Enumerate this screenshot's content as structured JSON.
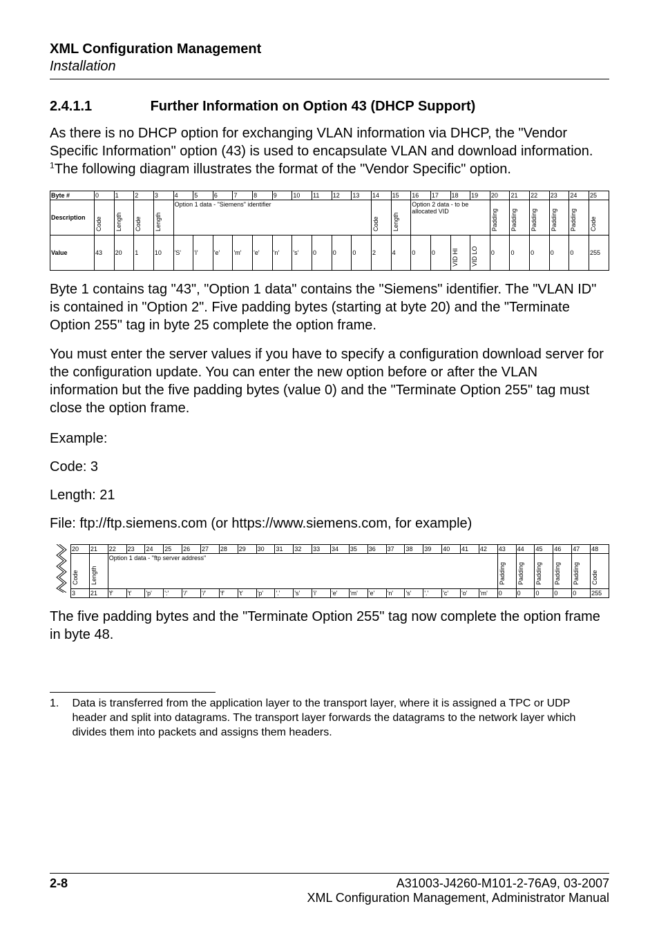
{
  "header": {
    "title": "XML Configuration Management",
    "subtitle": "Installation"
  },
  "section": {
    "number": "2.4.1.1",
    "title": "Further Information on Option 43 (DHCP Support)"
  },
  "paragraphs": {
    "p1a": "As there is no DHCP option for exchanging VLAN information via DHCP, the \"Vendor Specific Information\" option (43) is used to encapsulate VLAN and download information. ",
    "p1b": "The following diagram illustrates the format of the \"Vendor Specific\" option.",
    "p2": "Byte 1 contains tag \"43\", \"Option 1 data\" contains the \"Siemens\" identifier. The \"VLAN ID\" is contained in \"Option 2\". Five padding bytes (starting at byte 20) and the \"Terminate Option 255\" tag in byte 25 complete the option frame.",
    "p3": "You must enter the server values if you have to specify a configuration download server for the configuration update. You can enter the new option before or after the VLAN information but the five padding bytes (value 0) and the \"Terminate Option 255\" tag must close the option frame.",
    "example_label": "Example:",
    "code_line": "Code: 3",
    "length_line": "Length: 21",
    "file_line": "File: ftp://ftp.siemens.com (or https://www.siemens.com, for example)",
    "p4": "The five padding bytes and the \"Terminate Option 255\" tag now complete the option frame in byte 48."
  },
  "table1": {
    "row_label_byte": "Byte #",
    "row_label_desc": "Description",
    "row_label_value": "Value",
    "byte_numbers": [
      "0",
      "1",
      "2",
      "3",
      "4",
      "5",
      "6",
      "7",
      "8",
      "9",
      "10",
      "11",
      "12",
      "13",
      "14",
      "15",
      "16",
      "17",
      "18",
      "19",
      "20",
      "21",
      "22",
      "23",
      "24",
      "25"
    ],
    "desc_vert": [
      "Code",
      "Length",
      "Code",
      "Length"
    ],
    "opt1_label": "Option 1 data - \"Siemens\" identifier",
    "desc_vert_mid": [
      "Code",
      "Length"
    ],
    "opt2_label": "Option 2 data - to be allocated VID",
    "desc_vert_end": [
      "Padding",
      "Padding",
      "Padding",
      "Padding",
      "Padding",
      "Code"
    ],
    "values": [
      "43",
      "20",
      "1",
      "10",
      "'S'",
      "'i'",
      "'e'",
      "'m'",
      "'e'",
      "'n'",
      "'s'",
      "0",
      "0",
      "0",
      "2",
      "4",
      "0",
      "0",
      "VID HI",
      "VID LO",
      "0",
      "0",
      "0",
      "0",
      "0",
      "255"
    ]
  },
  "table2": {
    "byte_numbers": [
      "20",
      "21",
      "22",
      "23",
      "24",
      "25",
      "26",
      "27",
      "28",
      "29",
      "30",
      "31",
      "32",
      "33",
      "34",
      "35",
      "36",
      "37",
      "38",
      "39",
      "40",
      "41",
      "42",
      "43",
      "44",
      "45",
      "46",
      "47",
      "48"
    ],
    "desc_vert_start": [
      "Code",
      "Length"
    ],
    "opt_label": "Option 1 data - \"ftp server address\"",
    "desc_vert_end": [
      "Padding",
      "Padding",
      "Padding",
      "Padding",
      "Padding",
      "Code"
    ],
    "values": [
      "3",
      "21",
      "'f'",
      "'t'",
      "'p'",
      "':'",
      "'/'",
      "'/'",
      "'f'",
      "'t'",
      "'p'",
      "'.'",
      "'s'",
      "'i'",
      "'e'",
      "'m'",
      "'e'",
      "'n'",
      "'s'",
      "'.'",
      "'c'",
      "'o'",
      "'m'",
      "0",
      "0",
      "0",
      "0",
      "0",
      "255"
    ]
  },
  "footnote": {
    "marker": "1",
    "marker_dot": "1.",
    "text": "Data is transferred from the application layer to the transport layer, where it is assigned a TPC or UDP header and split into datagrams. The transport layer forwards the datagrams to the network layer which divides them into packets and assigns them headers."
  },
  "footer": {
    "page": "2-8",
    "doc_id": "A31003-J4260-M101-2-76A9, 03-2007",
    "doc_title": "XML Configuration Management, Administrator Manual"
  }
}
